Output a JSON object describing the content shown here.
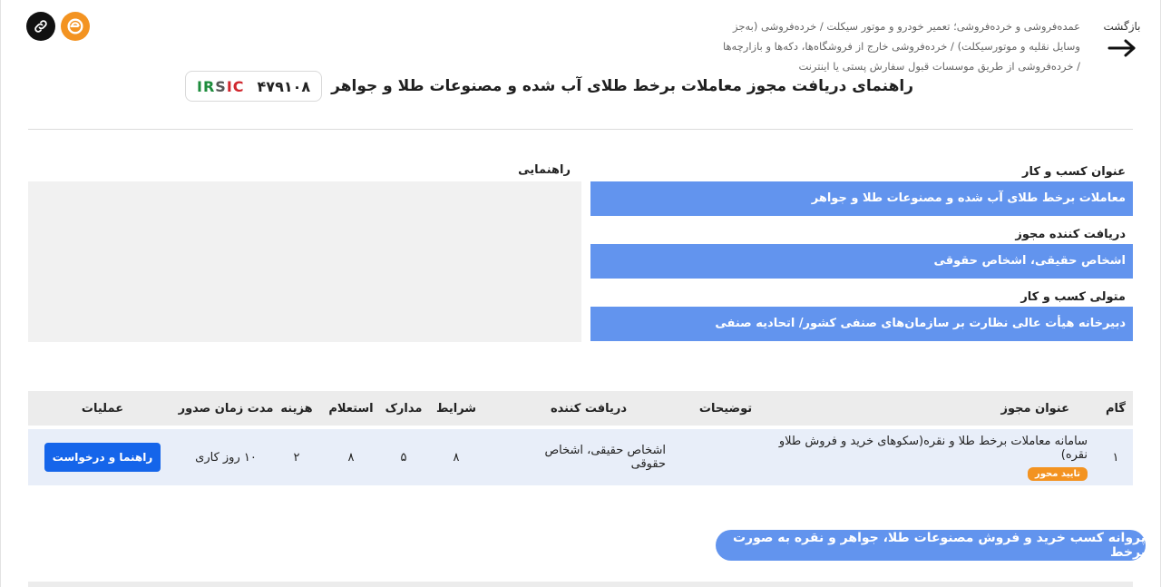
{
  "header": {
    "back_label": "بازگشت",
    "breadcrumb": "عمده‌فروشی و خرده‌فروشی؛ تعمیر خودرو و موتور سیکلت / خرده‌فروشی (به‌جز وسایل نقلیه و موتورسیکلت) / خرده‌فروشی خارج از فروشگاه‌ها، دکه‌ها و بازارچه‌ها / خرده‌فروشی از طریق موسسات قبول سفارش پستی یا اینترنت",
    "title": "راهنمای دریافت مجوز معاملات برخط طلای آب شده و مصنوعات طلا و جواهر",
    "logo_text": "IRSIC",
    "license_code": "۴۷۹۱۰۸",
    "icons": [
      "link-icon",
      "e-logo-icon"
    ]
  },
  "info": {
    "business_title_label": "عنوان کسب و کار",
    "business_title": "معاملات برخط طلای آب شده و مصنوعات طلا و جواهر",
    "recipient_label": "دریافت کننده مجوز",
    "recipient": "اشخاص حقیقی، اشخاص حقوقی",
    "custodian_label": "متولی کسب و کار",
    "custodian": "دبیرخانه هیأت عالی نظارت بر سازمان‌های صنفی کشور/ اتحادیه صنفی",
    "guide_label": "راهنمایی"
  },
  "table": {
    "headers": {
      "step": "گام",
      "license_title": "عنوان مجوز",
      "description": "توضیحات",
      "recipient": "دریافت کننده",
      "conditions": "شرایط",
      "documents": "مدارک",
      "inquiry": "استعلام",
      "cost": "هزینه",
      "duration": "مدت زمان صدور",
      "operations": "عملیات"
    },
    "rows": [
      {
        "step": "۱",
        "license_title": "سامانه معاملات برخط طلا و نقره(سکوهای خرید و فروش طلاو نقره)",
        "badge": "تایید محور",
        "description": "",
        "recipient": "اشخاص حقیقی، اشخاص حقوقی",
        "conditions": "۸",
        "documents": "۵",
        "inquiry": "۸",
        "cost": "۲",
        "duration": "۱۰ روز کاری",
        "action_label": "راهنما و درخواست"
      }
    ]
  },
  "bottom": {
    "pill_label": "پروانه کسب خرید و فروش مصنوعات طلا، جواهر و نقره به صورت برخط"
  },
  "colors": {
    "accent_blue": "#6294ee",
    "button_blue": "#1565ea",
    "badge_orange": "#f39321",
    "row_bg": "#e8eef9",
    "header_bg": "#ececec"
  }
}
